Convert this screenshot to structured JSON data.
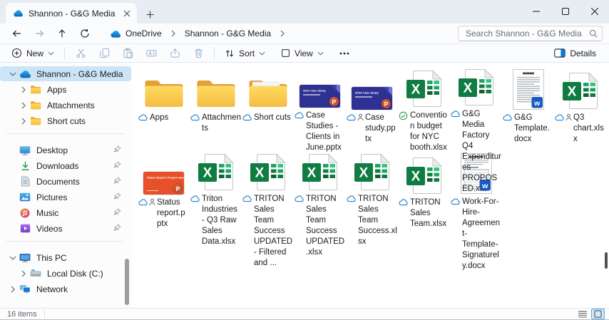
{
  "window": {
    "tab_title": "Shannon - G&G Media",
    "controls": [
      "minimize-icon",
      "maximize-icon",
      "close-icon"
    ]
  },
  "addressbar": {
    "nav_icons": [
      "back-icon",
      "forward-icon",
      "up-icon",
      "refresh-icon"
    ],
    "breadcrumb": [
      "OneDrive",
      "Shannon - G&G Media"
    ],
    "search_placeholder": "Search Shannon - G&G Media"
  },
  "toolbar": {
    "new_label": "New",
    "action_icons": [
      "cut-icon",
      "copy-icon",
      "paste-icon",
      "rename-icon",
      "share-icon",
      "delete-icon"
    ],
    "sort_label": "Sort",
    "view_label": "View",
    "more_icon": "ellipsis-icon",
    "details_label": "Details"
  },
  "sidebar": {
    "sections": [
      {
        "name": "onedrive-tree",
        "items": [
          {
            "label": "Shannon - G&G Media",
            "icon": "onedrive",
            "chevron": "down",
            "indent": 0,
            "selected": true
          },
          {
            "label": "Apps",
            "icon": "folder",
            "chevron": "right",
            "indent": 1
          },
          {
            "label": "Attachments",
            "icon": "folder",
            "chevron": "right",
            "indent": 1
          },
          {
            "label": "Short cuts",
            "icon": "folder",
            "chevron": "right",
            "indent": 1
          }
        ]
      },
      {
        "name": "quick-access",
        "items": [
          {
            "label": "Desktop",
            "icon": "desktop",
            "pinned": true
          },
          {
            "label": "Downloads",
            "icon": "downloads",
            "pinned": true
          },
          {
            "label": "Documents",
            "icon": "documents",
            "pinned": true
          },
          {
            "label": "Pictures",
            "icon": "pictures",
            "pinned": true
          },
          {
            "label": "Music",
            "icon": "music",
            "pinned": true
          },
          {
            "label": "Videos",
            "icon": "videos",
            "pinned": true
          }
        ]
      },
      {
        "name": "system-tree",
        "items": [
          {
            "label": "This PC",
            "icon": "thispc",
            "chevron": "down",
            "indent": 0
          },
          {
            "label": "Local Disk (C:)",
            "icon": "disk",
            "chevron": "right",
            "indent": 1
          },
          {
            "label": "Network",
            "icon": "network",
            "chevron": "right",
            "indent": 0
          }
        ]
      }
    ]
  },
  "main": {
    "items": [
      {
        "label": "Apps",
        "type": "folder",
        "status": "cloud"
      },
      {
        "label": "Attachments",
        "type": "folder",
        "status": "cloud"
      },
      {
        "label": "Short cuts",
        "type": "folder-paper",
        "status": "cloud"
      },
      {
        "label": "Case Studies - Clients in June.pptx",
        "type": "pptx-blue",
        "status": "cloud",
        "thumb_title": "2022 Case Study"
      },
      {
        "label": "Case study.pptx",
        "type": "pptx-blue",
        "status": "cloud-shared",
        "thumb_title": "20XX Case Study"
      },
      {
        "label": "Convention budget for NYC booth.xlsx",
        "type": "xlsx",
        "status": "check"
      },
      {
        "label": "G&G Media Factory Q4 Expenditures PROPOSED.x...",
        "type": "xlsx",
        "status": "cloud"
      },
      {
        "label": "G&G Template.docx",
        "type": "docx-text",
        "status": "cloud"
      },
      {
        "label": "Q3 chart.xlsx",
        "type": "xlsx",
        "status": "cloud-shared"
      },
      {
        "label": "Status report.pptx",
        "type": "pptx-orange",
        "status": "cloud-shared",
        "thumb_title": "Status Report: Project name"
      },
      {
        "label": "Triton Industries - Q3 Raw Sales Data.xlsx",
        "type": "xlsx",
        "status": "cloud"
      },
      {
        "label": "TRITON Sales Team Success UPDATED - Filtered and ...",
        "type": "xlsx",
        "status": "cloud"
      },
      {
        "label": "TRITON Sales Team Success UPDATED.xlsx",
        "type": "xlsx",
        "status": "cloud"
      },
      {
        "label": "TRITON Sales Team Success.xlsx",
        "type": "xlsx",
        "status": "cloud"
      },
      {
        "label": "TRITON Sales Team.xlsx",
        "type": "xlsx",
        "status": "cloud"
      },
      {
        "label": "Work-For-Hire-Agreement-Template-Signaturely.docx",
        "type": "docx-table",
        "status": "cloud"
      }
    ]
  },
  "statusbar": {
    "items_count": "16 items",
    "view_toggle_icons": [
      "list-view-icon",
      "tiles-view-icon"
    ]
  },
  "colors": {
    "accent": "#0067c0",
    "selected_bg": "#cce4f7",
    "excel_green": "#107c41",
    "word_blue": "#185abd",
    "ppt_slide_blue": "#2e3192",
    "ppt_slide_orange": "#e7502a",
    "folder_yellow": "#fdcd4e"
  }
}
